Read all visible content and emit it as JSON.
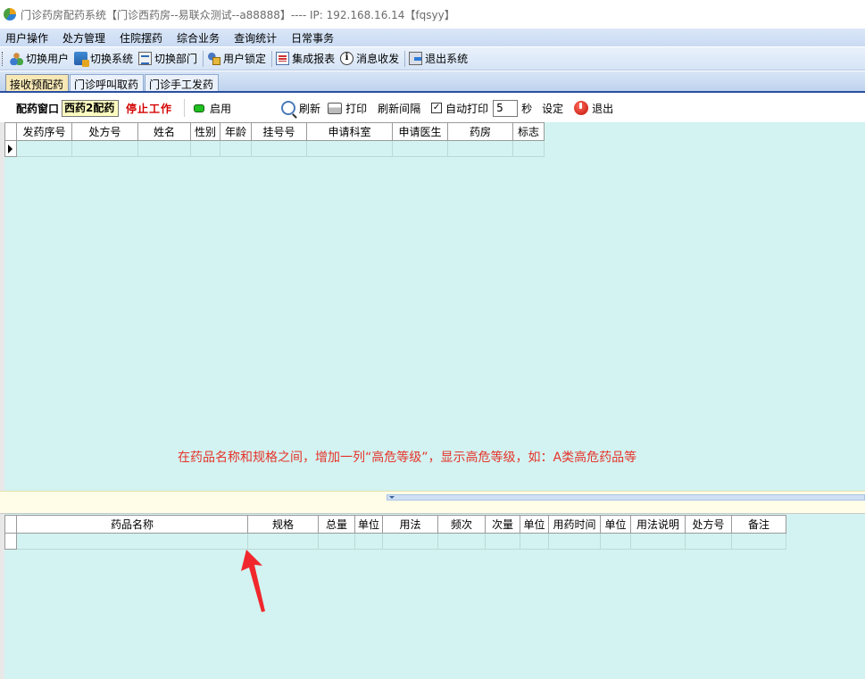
{
  "window": {
    "title": "门诊药房配药系统【门诊西药房--易联众测试--a88888】---- IP: 192.168.16.14【fqsyy】"
  },
  "menubar": {
    "items": [
      "用户操作",
      "处方管理",
      "住院摆药",
      "综合业务",
      "查询统计",
      "日常事务"
    ]
  },
  "toolbar": {
    "switch_user": "切换用户",
    "switch_system": "切换系统",
    "switch_dept": "切换部门",
    "lock_user": "用户锁定",
    "report": "集成报表",
    "messages": "消息收发",
    "exit": "退出系统"
  },
  "tabs": [
    "接收预配药",
    "门诊呼叫取药",
    "门诊手工发药"
  ],
  "controls": {
    "window_label": "配药窗口",
    "window_value": "西药2配药",
    "stop_label": "停止工作",
    "enable_label": "启用",
    "refresh_label": "刷新",
    "print_label": "打印",
    "interval_label": "刷新间隔",
    "auto_print_label": "自动打印",
    "auto_print_checked": true,
    "seconds_value": "5",
    "seconds_unit": "秒",
    "set_label": "设定",
    "exit_label": "退出"
  },
  "top_grid": {
    "columns": [
      "发药序号",
      "处方号",
      "姓名",
      "性别",
      "年龄",
      "挂号号",
      "申请科室",
      "申请医生",
      "药房",
      "标志"
    ]
  },
  "bottom_grid": {
    "columns": [
      "药品名称",
      "规格",
      "总量",
      "单位",
      "用法",
      "频次",
      "次量",
      "单位",
      "用药时间",
      "单位",
      "用法说明",
      "处方号",
      "备注"
    ]
  },
  "annotation": {
    "text": "在药品名称和规格之间，增加一列“高危等级”，显示高危等级，如：A类高危药品等",
    "color": "#e6332a"
  }
}
